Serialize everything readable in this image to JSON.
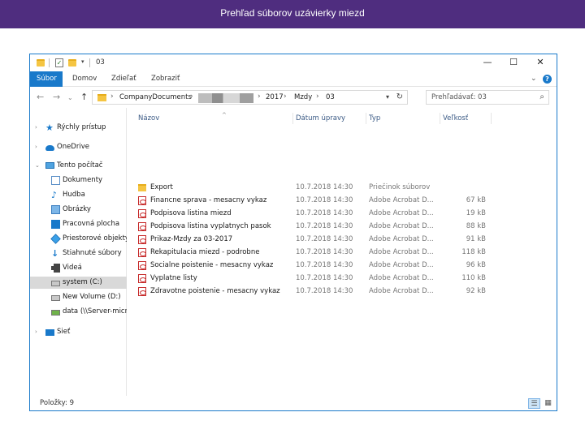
{
  "slide": {
    "title": "Prehľad súborov uzávierky miezd"
  },
  "window": {
    "title": "03",
    "controls": {
      "minimize": "—",
      "maximize": "☐",
      "close": "✕"
    }
  },
  "ribbon": {
    "tabs": [
      "Súbor",
      "Domov",
      "Zdieľať",
      "Zobraziť"
    ],
    "expand": "⌄",
    "help": "?"
  },
  "nav": {
    "back": "←",
    "forward": "→",
    "recent": "⌄",
    "up": "↑",
    "breadcrumb": [
      "CompanyDocuments",
      "2017",
      "Mzdy",
      "03"
    ],
    "search_placeholder": "Prehľadávať: 03"
  },
  "sidebar": {
    "items": [
      {
        "label": "Rýchly prístup",
        "icon": "quick-access-star-icon"
      },
      {
        "label": "OneDrive",
        "icon": "onedrive-cloud-icon"
      },
      {
        "label": "Tento počítač",
        "icon": "this-pc-icon"
      },
      {
        "label": "Dokumenty",
        "icon": "documents-icon"
      },
      {
        "label": "Hudba",
        "icon": "music-icon"
      },
      {
        "label": "Obrázky",
        "icon": "pictures-icon"
      },
      {
        "label": "Pracovná plocha",
        "icon": "desktop-icon"
      },
      {
        "label": "Priestorové objekty",
        "icon": "3d-objects-icon"
      },
      {
        "label": "Stiahnuté súbory",
        "icon": "downloads-icon"
      },
      {
        "label": "Videá",
        "icon": "videos-icon"
      },
      {
        "label": "system (C:)",
        "icon": "drive-icon"
      },
      {
        "label": "New Volume (D:)",
        "icon": "drive-icon"
      },
      {
        "label": "data (\\\\Server-micro",
        "icon": "network-drive-icon"
      },
      {
        "label": "Sieť",
        "icon": "network-icon"
      }
    ]
  },
  "list": {
    "columns": [
      "Názov",
      "Dátum úpravy",
      "Typ",
      "Veľkosť"
    ],
    "rows": [
      {
        "name": "Export",
        "date": "10.7.2018 14:30",
        "type": "Priečinok súborov",
        "size": "",
        "kind": "folder"
      },
      {
        "name": "Financne sprava - mesacny vykaz",
        "date": "10.7.2018 14:30",
        "type": "Adobe Acrobat D...",
        "size": "67 kB",
        "kind": "pdf"
      },
      {
        "name": "Podpisova listina miezd",
        "date": "10.7.2018 14:30",
        "type": "Adobe Acrobat D...",
        "size": "19 kB",
        "kind": "pdf"
      },
      {
        "name": "Podpisova listina vyplatnych pasok",
        "date": "10.7.2018 14:30",
        "type": "Adobe Acrobat D...",
        "size": "88 kB",
        "kind": "pdf"
      },
      {
        "name": "Prikaz-Mzdy za 03-2017",
        "date": "10.7.2018 14:30",
        "type": "Adobe Acrobat D...",
        "size": "91 kB",
        "kind": "pdf"
      },
      {
        "name": "Rekapitulacia miezd - podrobne",
        "date": "10.7.2018 14:30",
        "type": "Adobe Acrobat D...",
        "size": "118 kB",
        "kind": "pdf"
      },
      {
        "name": "Socialne poistenie - mesacny vykaz",
        "date": "10.7.2018 14:30",
        "type": "Adobe Acrobat D...",
        "size": "96 kB",
        "kind": "pdf"
      },
      {
        "name": "Vyplatne listy",
        "date": "10.7.2018 14:30",
        "type": "Adobe Acrobat D...",
        "size": "110 kB",
        "kind": "pdf"
      },
      {
        "name": "Zdravotne poistenie - mesacny vykaz",
        "date": "10.7.2018 14:30",
        "type": "Adobe Acrobat D...",
        "size": "92 kB",
        "kind": "pdf"
      }
    ]
  },
  "status": {
    "items_count": "Položky: 9"
  },
  "colors": {
    "accent": "#1979ca",
    "slide_bar": "#4f2d7f",
    "folder": "#f5c542",
    "pdf": "#c62828"
  }
}
